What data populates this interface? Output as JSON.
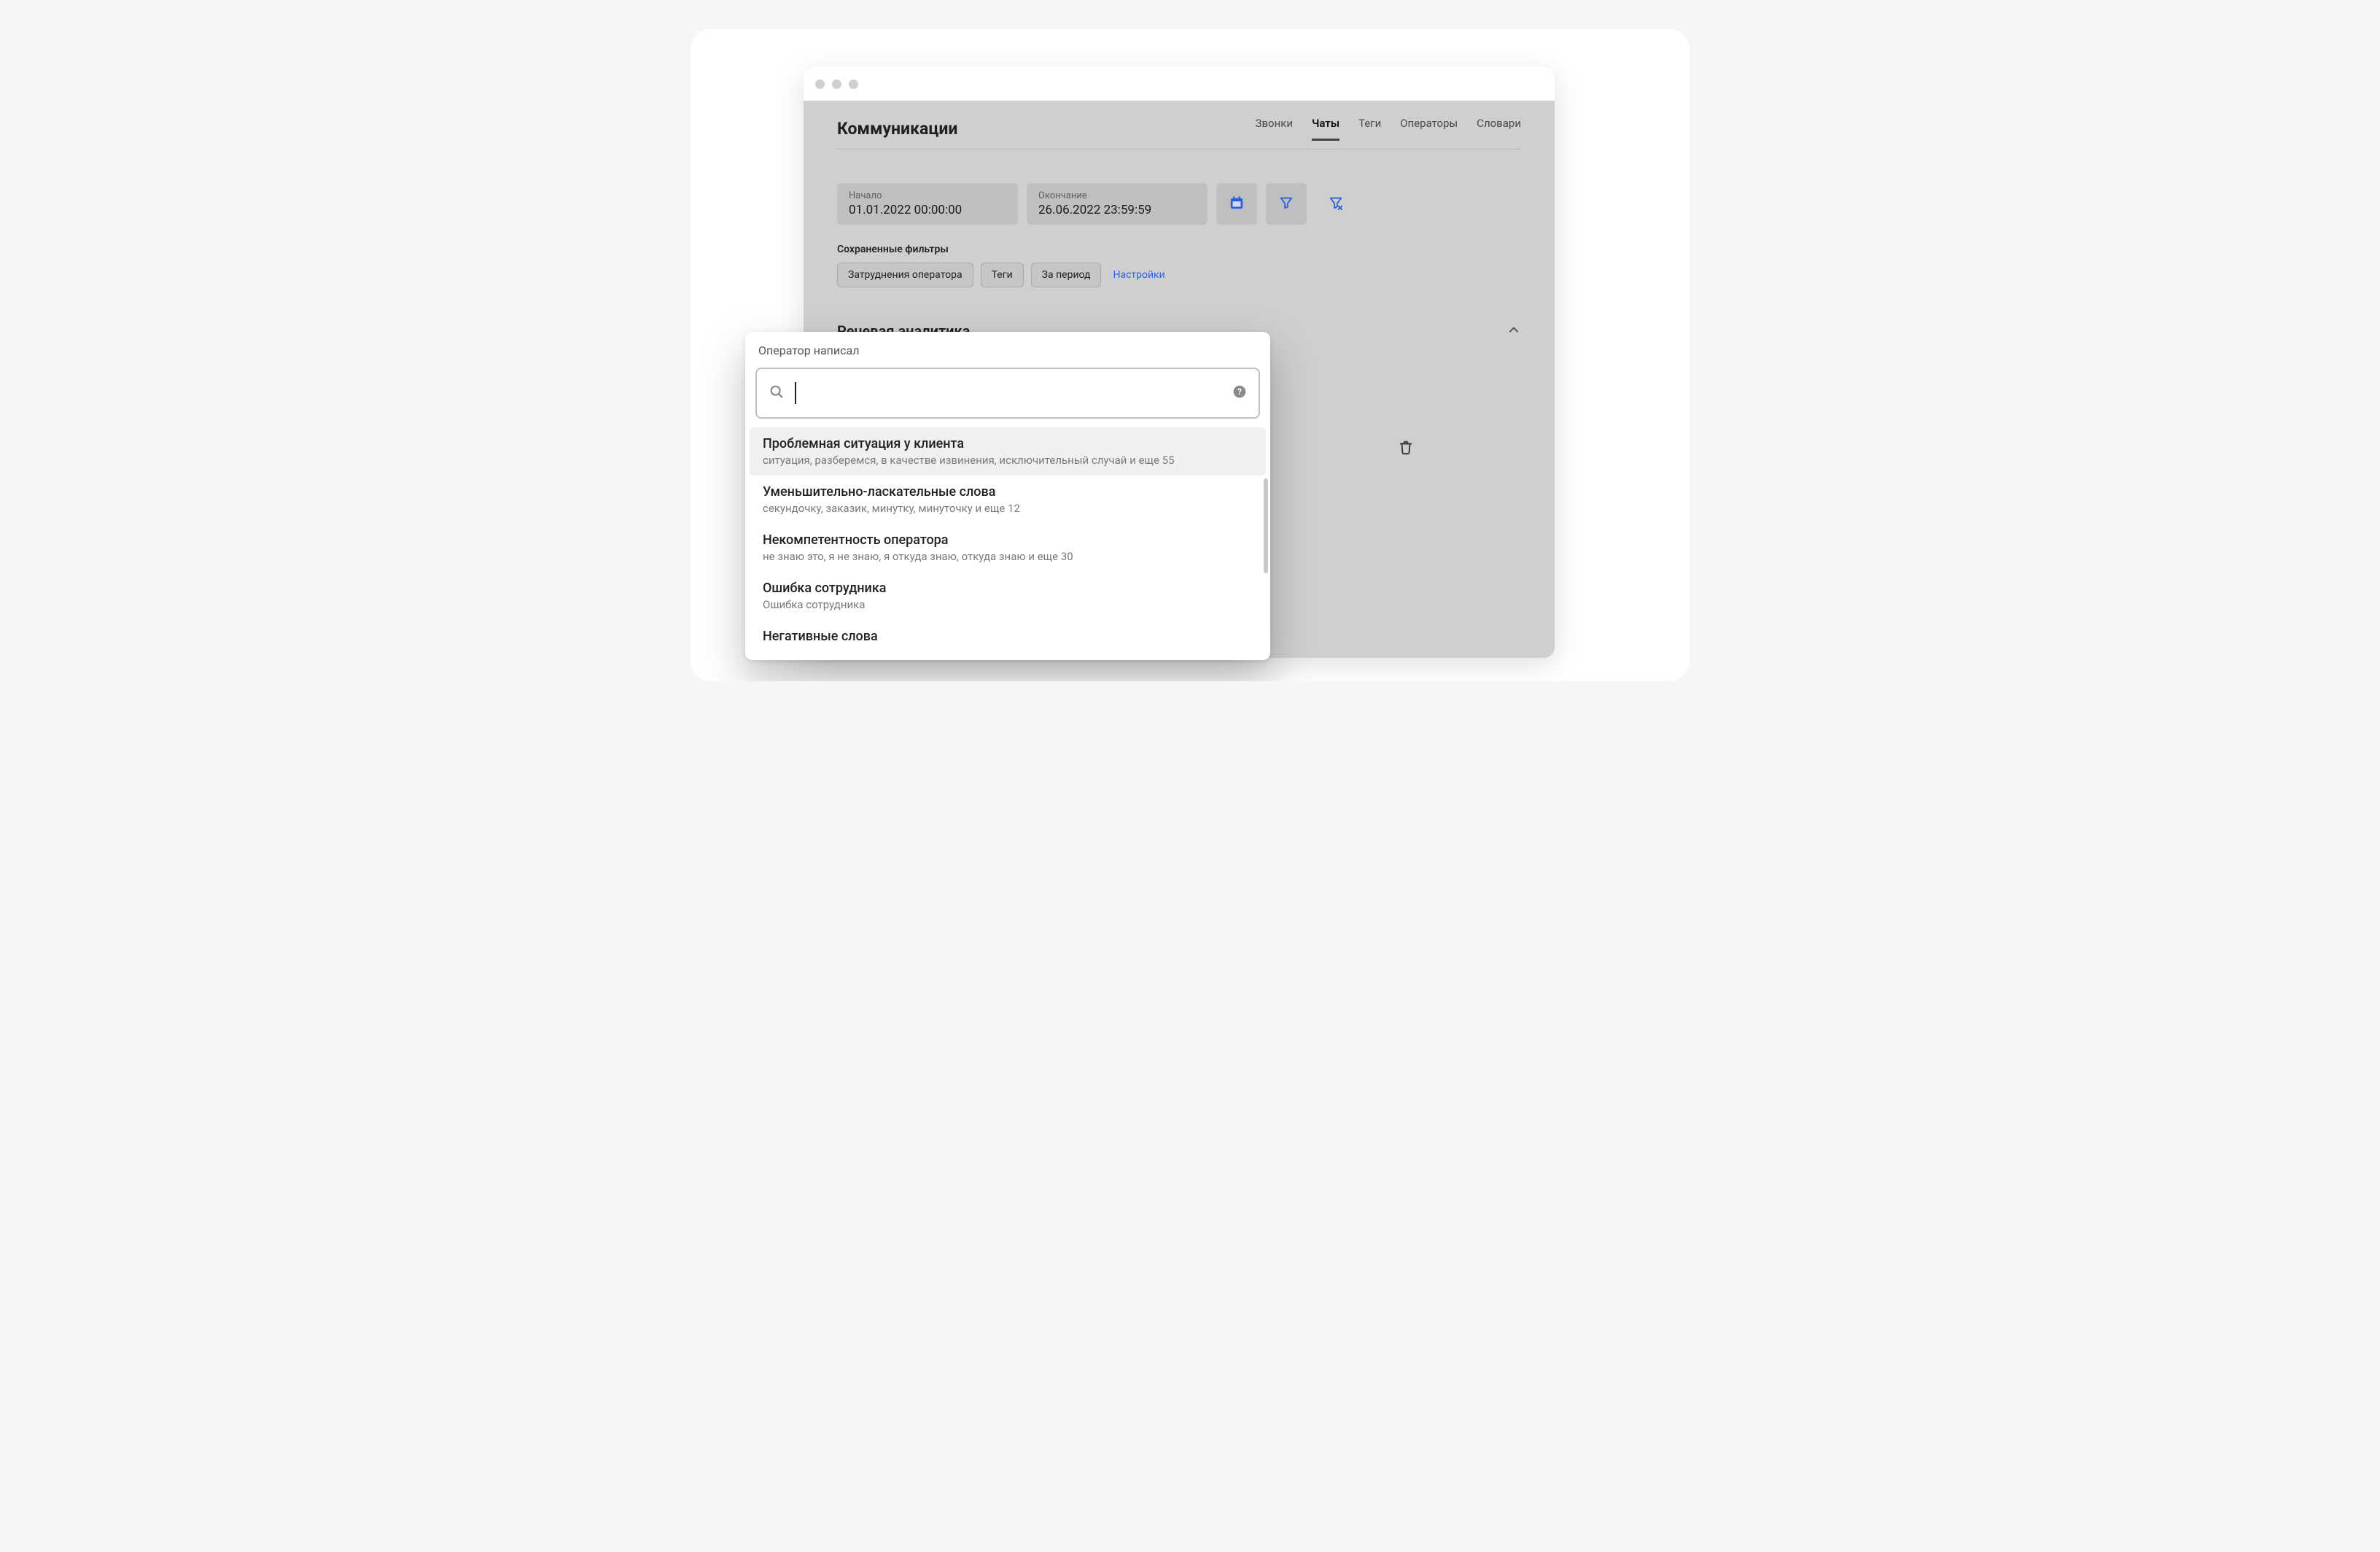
{
  "header": {
    "title": "Коммуникации",
    "tabs": [
      {
        "label": "Звонки",
        "active": false
      },
      {
        "label": "Чаты",
        "active": true
      },
      {
        "label": "Теги",
        "active": false
      },
      {
        "label": "Операторы",
        "active": false
      },
      {
        "label": "Словари",
        "active": false
      }
    ]
  },
  "date_filters": {
    "start": {
      "label": "Начало",
      "value": "01.01.2022 00:00:00"
    },
    "end": {
      "label": "Окончание",
      "value": "26.06.2022 23:59:59"
    }
  },
  "saved_filters": {
    "label": "Сохраненные фильтры",
    "chips": [
      "Затруднения оператора",
      "Теги",
      "За период"
    ],
    "settings_link": "Настройки"
  },
  "section": {
    "title": "Речевая аналитика"
  },
  "dropdown": {
    "title": "Оператор написал",
    "search_placeholder": "",
    "items": [
      {
        "title": "Проблемная ситуация у клиента",
        "sub": "ситуация, разберемся, в качестве извинения, исключительный случай и еще 55",
        "hover": true
      },
      {
        "title": "Уменьшительно-ласкательные слова",
        "sub": "секундочку, заказик, минутку, минуточку и еще 12",
        "hover": false
      },
      {
        "title": "Некомпетентность оператора",
        "sub": "не знаю это, я не знаю, я откуда знаю, откуда знаю и еще 30",
        "hover": false
      },
      {
        "title": "Ошибка сотрудника",
        "sub": "Ошибка сотрудника",
        "hover": false
      },
      {
        "title": "Негативные слова",
        "sub": "",
        "hover": false
      }
    ]
  },
  "icons": {
    "calendar": "calendar-icon",
    "filter": "filter-icon",
    "filter_clear": "filter-clear-icon",
    "trash": "trash-icon",
    "search": "search-icon",
    "help": "help-icon",
    "chevron_up": "chevron-up-icon"
  },
  "colors": {
    "accent": "#2b63d9",
    "panel_bg": "#cfcfcf",
    "field_bg": "#bfbfbf"
  }
}
